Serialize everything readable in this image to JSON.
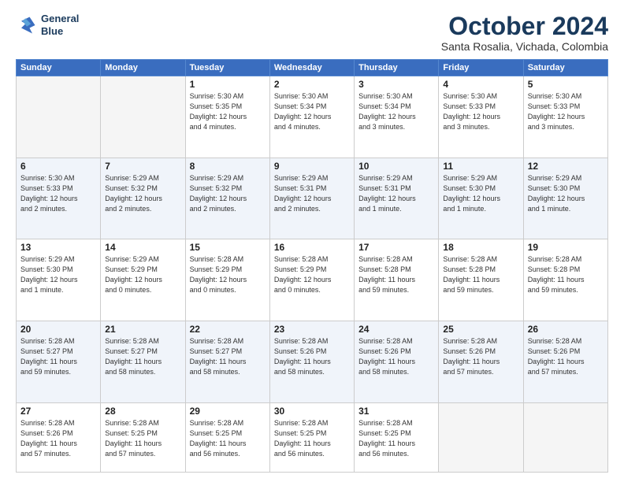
{
  "logo": {
    "line1": "General",
    "line2": "Blue"
  },
  "title": "October 2024",
  "location": "Santa Rosalia, Vichada, Colombia",
  "weekdays": [
    "Sunday",
    "Monday",
    "Tuesday",
    "Wednesday",
    "Thursday",
    "Friday",
    "Saturday"
  ],
  "weeks": [
    [
      {
        "day": "",
        "info": ""
      },
      {
        "day": "",
        "info": ""
      },
      {
        "day": "1",
        "info": "Sunrise: 5:30 AM\nSunset: 5:35 PM\nDaylight: 12 hours\nand 4 minutes."
      },
      {
        "day": "2",
        "info": "Sunrise: 5:30 AM\nSunset: 5:34 PM\nDaylight: 12 hours\nand 4 minutes."
      },
      {
        "day": "3",
        "info": "Sunrise: 5:30 AM\nSunset: 5:34 PM\nDaylight: 12 hours\nand 3 minutes."
      },
      {
        "day": "4",
        "info": "Sunrise: 5:30 AM\nSunset: 5:33 PM\nDaylight: 12 hours\nand 3 minutes."
      },
      {
        "day": "5",
        "info": "Sunrise: 5:30 AM\nSunset: 5:33 PM\nDaylight: 12 hours\nand 3 minutes."
      }
    ],
    [
      {
        "day": "6",
        "info": "Sunrise: 5:30 AM\nSunset: 5:33 PM\nDaylight: 12 hours\nand 2 minutes."
      },
      {
        "day": "7",
        "info": "Sunrise: 5:29 AM\nSunset: 5:32 PM\nDaylight: 12 hours\nand 2 minutes."
      },
      {
        "day": "8",
        "info": "Sunrise: 5:29 AM\nSunset: 5:32 PM\nDaylight: 12 hours\nand 2 minutes."
      },
      {
        "day": "9",
        "info": "Sunrise: 5:29 AM\nSunset: 5:31 PM\nDaylight: 12 hours\nand 2 minutes."
      },
      {
        "day": "10",
        "info": "Sunrise: 5:29 AM\nSunset: 5:31 PM\nDaylight: 12 hours\nand 1 minute."
      },
      {
        "day": "11",
        "info": "Sunrise: 5:29 AM\nSunset: 5:30 PM\nDaylight: 12 hours\nand 1 minute."
      },
      {
        "day": "12",
        "info": "Sunrise: 5:29 AM\nSunset: 5:30 PM\nDaylight: 12 hours\nand 1 minute."
      }
    ],
    [
      {
        "day": "13",
        "info": "Sunrise: 5:29 AM\nSunset: 5:30 PM\nDaylight: 12 hours\nand 1 minute."
      },
      {
        "day": "14",
        "info": "Sunrise: 5:29 AM\nSunset: 5:29 PM\nDaylight: 12 hours\nand 0 minutes."
      },
      {
        "day": "15",
        "info": "Sunrise: 5:28 AM\nSunset: 5:29 PM\nDaylight: 12 hours\nand 0 minutes."
      },
      {
        "day": "16",
        "info": "Sunrise: 5:28 AM\nSunset: 5:29 PM\nDaylight: 12 hours\nand 0 minutes."
      },
      {
        "day": "17",
        "info": "Sunrise: 5:28 AM\nSunset: 5:28 PM\nDaylight: 11 hours\nand 59 minutes."
      },
      {
        "day": "18",
        "info": "Sunrise: 5:28 AM\nSunset: 5:28 PM\nDaylight: 11 hours\nand 59 minutes."
      },
      {
        "day": "19",
        "info": "Sunrise: 5:28 AM\nSunset: 5:28 PM\nDaylight: 11 hours\nand 59 minutes."
      }
    ],
    [
      {
        "day": "20",
        "info": "Sunrise: 5:28 AM\nSunset: 5:27 PM\nDaylight: 11 hours\nand 59 minutes."
      },
      {
        "day": "21",
        "info": "Sunrise: 5:28 AM\nSunset: 5:27 PM\nDaylight: 11 hours\nand 58 minutes."
      },
      {
        "day": "22",
        "info": "Sunrise: 5:28 AM\nSunset: 5:27 PM\nDaylight: 11 hours\nand 58 minutes."
      },
      {
        "day": "23",
        "info": "Sunrise: 5:28 AM\nSunset: 5:26 PM\nDaylight: 11 hours\nand 58 minutes."
      },
      {
        "day": "24",
        "info": "Sunrise: 5:28 AM\nSunset: 5:26 PM\nDaylight: 11 hours\nand 58 minutes."
      },
      {
        "day": "25",
        "info": "Sunrise: 5:28 AM\nSunset: 5:26 PM\nDaylight: 11 hours\nand 57 minutes."
      },
      {
        "day": "26",
        "info": "Sunrise: 5:28 AM\nSunset: 5:26 PM\nDaylight: 11 hours\nand 57 minutes."
      }
    ],
    [
      {
        "day": "27",
        "info": "Sunrise: 5:28 AM\nSunset: 5:26 PM\nDaylight: 11 hours\nand 57 minutes."
      },
      {
        "day": "28",
        "info": "Sunrise: 5:28 AM\nSunset: 5:25 PM\nDaylight: 11 hours\nand 57 minutes."
      },
      {
        "day": "29",
        "info": "Sunrise: 5:28 AM\nSunset: 5:25 PM\nDaylight: 11 hours\nand 56 minutes."
      },
      {
        "day": "30",
        "info": "Sunrise: 5:28 AM\nSunset: 5:25 PM\nDaylight: 11 hours\nand 56 minutes."
      },
      {
        "day": "31",
        "info": "Sunrise: 5:28 AM\nSunset: 5:25 PM\nDaylight: 11 hours\nand 56 minutes."
      },
      {
        "day": "",
        "info": ""
      },
      {
        "day": "",
        "info": ""
      }
    ]
  ]
}
